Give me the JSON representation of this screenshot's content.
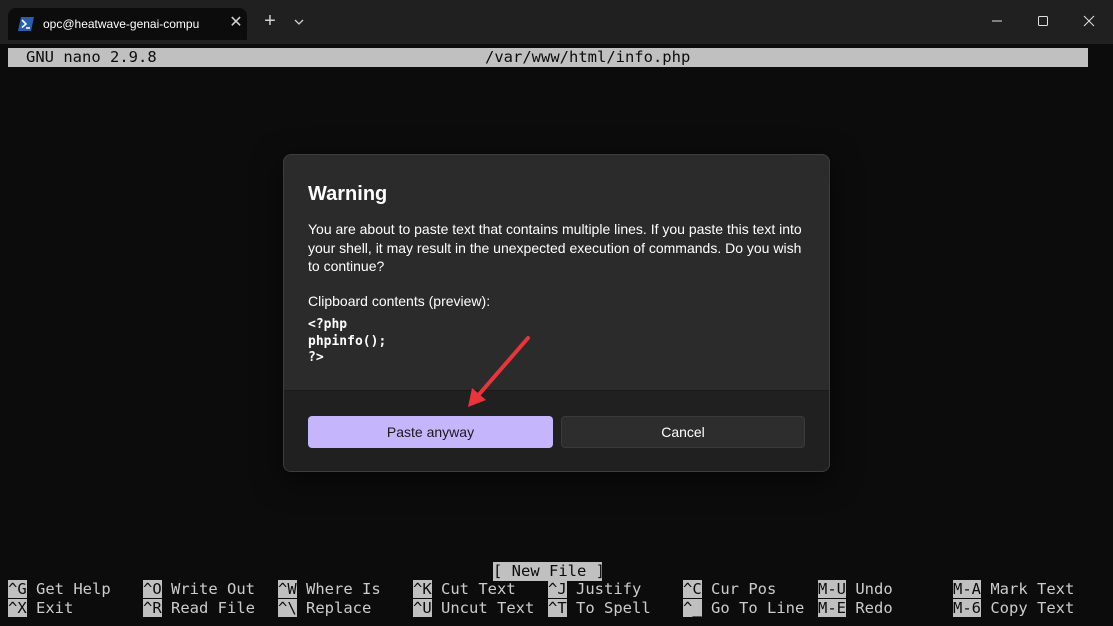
{
  "window": {
    "tab_title": "opc@heatwave-genai-compu",
    "tab_icon": "powershell-icon",
    "close_glyph": "✕",
    "new_tab_glyph": "+",
    "accent": "#c4b5fd"
  },
  "nano": {
    "version": "GNU nano 2.9.8",
    "filename": "/var/www/html/info.php",
    "status": "[ New File ]",
    "shortcuts_row1": [
      {
        "key": "^G",
        "label": "Get Help"
      },
      {
        "key": "^O",
        "label": "Write Out"
      },
      {
        "key": "^W",
        "label": "Where Is"
      },
      {
        "key": "^K",
        "label": "Cut Text"
      },
      {
        "key": "^J",
        "label": "Justify"
      },
      {
        "key": "^C",
        "label": "Cur Pos"
      },
      {
        "key": "M-U",
        "label": "Undo"
      },
      {
        "key": "M-A",
        "label": "Mark Text"
      }
    ],
    "shortcuts_row2": [
      {
        "key": "^X",
        "label": "Exit"
      },
      {
        "key": "^R",
        "label": "Read File"
      },
      {
        "key": "^\\",
        "label": "Replace"
      },
      {
        "key": "^U",
        "label": "Uncut Text"
      },
      {
        "key": "^T",
        "label": "To Spell"
      },
      {
        "key": "^_",
        "label": "Go To Line"
      },
      {
        "key": "M-E",
        "label": "Redo"
      },
      {
        "key": "M-6",
        "label": "Copy Text"
      }
    ]
  },
  "dialog": {
    "title": "Warning",
    "message": "You are about to paste text that contains multiple lines. If you paste this text into your shell, it may result in the unexpected execution of commands. Do you wish to continue?",
    "clipboard_label": "Clipboard contents (preview):",
    "clipboard_content": "<?php\nphpinfo();\n?>",
    "primary_button": "Paste anyway",
    "secondary_button": "Cancel"
  },
  "annotation": {
    "arrow_color": "#e8343a"
  }
}
